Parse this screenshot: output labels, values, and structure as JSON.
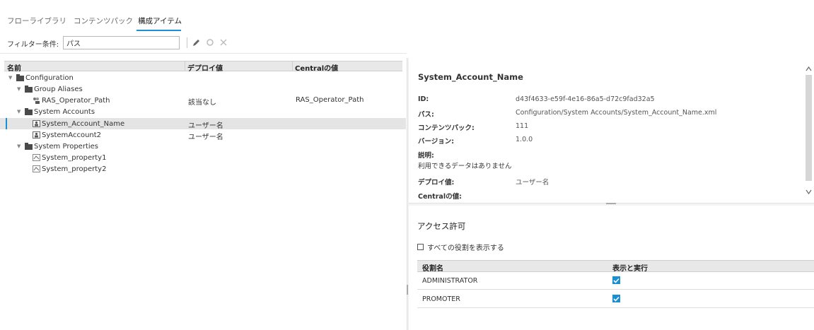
{
  "tabs": [
    {
      "label": "フローライブラリ"
    },
    {
      "label": "コンテンツパック"
    },
    {
      "label": "構成アイテム"
    }
  ],
  "filter": {
    "label": "フィルター条件:",
    "value": "パス"
  },
  "tree": {
    "columns": [
      "名前",
      "デプロイ値",
      "Centralの値"
    ],
    "rows": [
      {
        "name": "Configuration",
        "deploy": "",
        "central": ""
      },
      {
        "name": "Group Aliases",
        "deploy": "",
        "central": ""
      },
      {
        "name": "RAS_Operator_Path",
        "deploy": "該当なし",
        "central": "RAS_Operator_Path"
      },
      {
        "name": "System Accounts",
        "deploy": "",
        "central": ""
      },
      {
        "name": "System_Account_Name",
        "deploy": "ユーザー名",
        "central": ""
      },
      {
        "name": "SystemAccount2",
        "deploy": "ユーザー名",
        "central": ""
      },
      {
        "name": "System Properties",
        "deploy": "",
        "central": ""
      },
      {
        "name": "System_property1",
        "deploy": "",
        "central": ""
      },
      {
        "name": "System_property2",
        "deploy": "",
        "central": ""
      }
    ]
  },
  "details": {
    "title": "System_Account_Name",
    "id_label": "ID:",
    "id_value": "d43f4633-e59f-4e16-86a5-d72c9fad32a5",
    "path_label": "パス:",
    "path_value": "Configuration/System Accounts/System_Account_Name.xml",
    "pack_label": "コンテンツパック:",
    "pack_value": "111",
    "version_label": "バージョン:",
    "version_value": "1.0.0",
    "desc_label": "説明:",
    "desc_value": "利用できるデータはありません",
    "deploy_label": "デプロイ値:",
    "deploy_value": "ユーザー名",
    "central_label": "Centralの値:"
  },
  "access": {
    "title": "アクセス許可",
    "show_all_label": "すべての役割を表示する",
    "columns": [
      "役割名",
      "表示と実行"
    ],
    "rows": [
      {
        "role": "ADMINISTRATOR",
        "checked": true
      },
      {
        "role": "PROMOTER",
        "checked": true
      }
    ]
  },
  "colors": {
    "accent": "#1a8fd1",
    "folder": "#4a4a4a"
  }
}
